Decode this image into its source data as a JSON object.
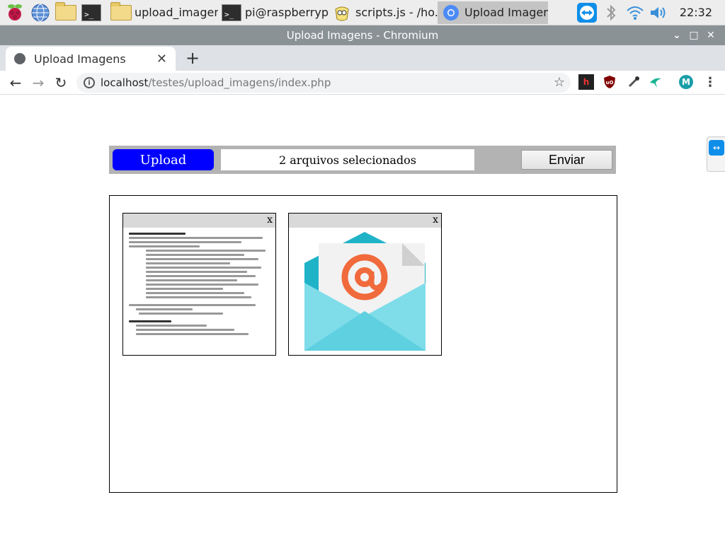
{
  "taskbar": {
    "tasks": [
      {
        "label": "upload_imagens",
        "icon": "folder-icon"
      },
      {
        "label": "pi@raspberrypi...",
        "icon": "terminal-icon"
      },
      {
        "label": "scripts.js - /ho...",
        "icon": "geany-icon"
      },
      {
        "label": "Upload Imagen...",
        "icon": "chromium-icon",
        "active": true
      }
    ],
    "clock": "22:32"
  },
  "window": {
    "title": "Upload Imagens - Chromium"
  },
  "browser": {
    "tab_title": "Upload Imagens",
    "url_host": "localhost",
    "url_path": "/testes/upload_imagens/index.php",
    "profile_initial": "M"
  },
  "page": {
    "upload_label": "Upload",
    "file_status": "2 arquivos selecionados",
    "submit_label": "Enviar",
    "thumbnails": [
      {
        "close_label": "x",
        "kind": "document"
      },
      {
        "close_label": "x",
        "kind": "email-image"
      }
    ]
  },
  "colors": {
    "upload_button": "#0000ff",
    "upload_bar": "#b3b3b3",
    "titlebar": "#8a9296"
  }
}
